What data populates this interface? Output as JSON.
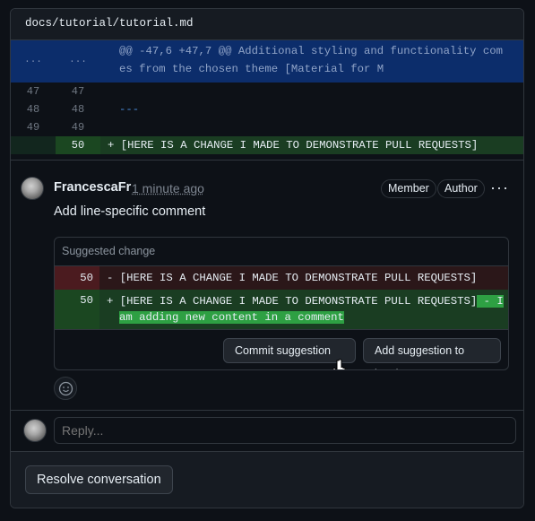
{
  "file": {
    "path": "docs/tutorial/tutorial.md"
  },
  "diff": {
    "hunk": {
      "old_marker": "...",
      "new_marker": "...",
      "text": "@@ -47,6 +47,7 @@ Additional styling and functionality comes from the chosen theme [Material for M"
    },
    "lines": [
      {
        "old": "47",
        "new": "47",
        "prefix": "",
        "text": ""
      },
      {
        "old": "48",
        "new": "48",
        "prefix": "",
        "text": "---"
      },
      {
        "old": "49",
        "new": "49",
        "prefix": "",
        "text": ""
      },
      {
        "old": "",
        "new": "50",
        "prefix": "+",
        "text": "[HERE IS A CHANGE I MADE TO DEMONSTRATE PULL REQUESTS]"
      }
    ]
  },
  "comment": {
    "author": "FrancescaFr",
    "time": "1 minute ago",
    "badges": [
      "Member",
      "Author"
    ],
    "more_icon": "kebab-horizontal-icon",
    "body": "Add line-specific comment",
    "suggestion": {
      "title": "Suggested change",
      "deleted": {
        "line": "50",
        "prefix": "-",
        "text": "[HERE IS A CHANGE I MADE TO DEMONSTRATE PULL REQUESTS]"
      },
      "added": {
        "line": "50",
        "prefix": "+",
        "text": "[HERE IS A CHANGE I MADE TO DEMONSTRATE PULL REQUESTS]",
        "highlight_line1": " - I",
        "highlight_line2": "am adding new content in a comment"
      },
      "commit_label": "Commit suggestion",
      "batch_label": "Add suggestion to batch"
    }
  },
  "reply": {
    "placeholder": "Reply..."
  },
  "resolve_label": "Resolve conversation",
  "colors": {
    "background": "#0d1117",
    "hunk_bg": "#0c2d6b",
    "addition_bg": "#1a3d22",
    "deletion_bg": "#2b1719",
    "addition_highlight": "#2ea043"
  }
}
